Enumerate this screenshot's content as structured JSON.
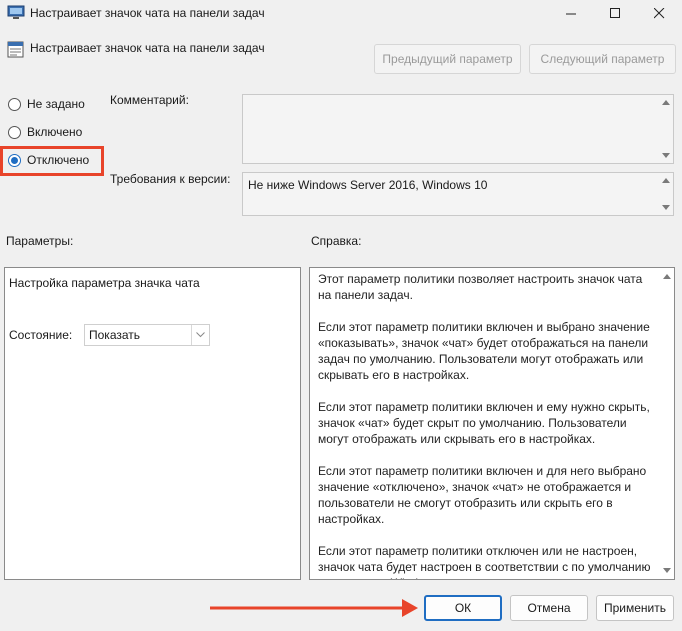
{
  "window": {
    "title": "Настраивает значок чата на панели задач",
    "controls": [
      "minimize-icon",
      "maximize-icon",
      "close-icon"
    ]
  },
  "header": {
    "policy_title": "Настраивает значок чата на панели задач",
    "prev_button": "Предыдущий параметр",
    "next_button": "Следующий параметр"
  },
  "state": {
    "options": [
      {
        "label": "Не задано",
        "checked": false
      },
      {
        "label": "Включено",
        "checked": false
      },
      {
        "label": "Отключено",
        "checked": true
      }
    ],
    "highlight_color": "#e8442a"
  },
  "comment": {
    "label": "Комментарий:",
    "value": ""
  },
  "requirements": {
    "label": "Требования к версии:",
    "value": "Не ниже Windows Server 2016, Windows 10"
  },
  "parameters": {
    "label": "Параметры:",
    "heading": "Настройка параметра значка чата",
    "state_label": "Состояние:",
    "state_value": "Показать"
  },
  "help": {
    "label": "Справка:",
    "paragraphs": [
      "Этот параметр политики позволяет настроить значок чата на панели задач.",
      "Если этот параметр политики включен и выбрано значение «показывать», значок «чат» будет отображаться на панели задач по умолчанию. Пользователи могут отображать или скрывать его в настройках.",
      "Если этот параметр политики включен и ему нужно скрыть, значок «чат» будет скрыт по умолчанию. Пользователи могут отображать или скрывать его в настройках.",
      "Если этот параметр политики включен и для него выбрано значение «отключено», значок «чат» не отображается и пользователи не смогут отобразить или скрыть его в настройках.",
      "Если этот параметр политики отключен или не настроен, значок чата будет настроен в соответствии с по умолчанию для выпуска Windows."
    ]
  },
  "footer": {
    "ok": "ОК",
    "cancel": "Отмена",
    "apply": "Применить",
    "arrow_color": "#e8442a",
    "accent": "#1f6dc2"
  }
}
